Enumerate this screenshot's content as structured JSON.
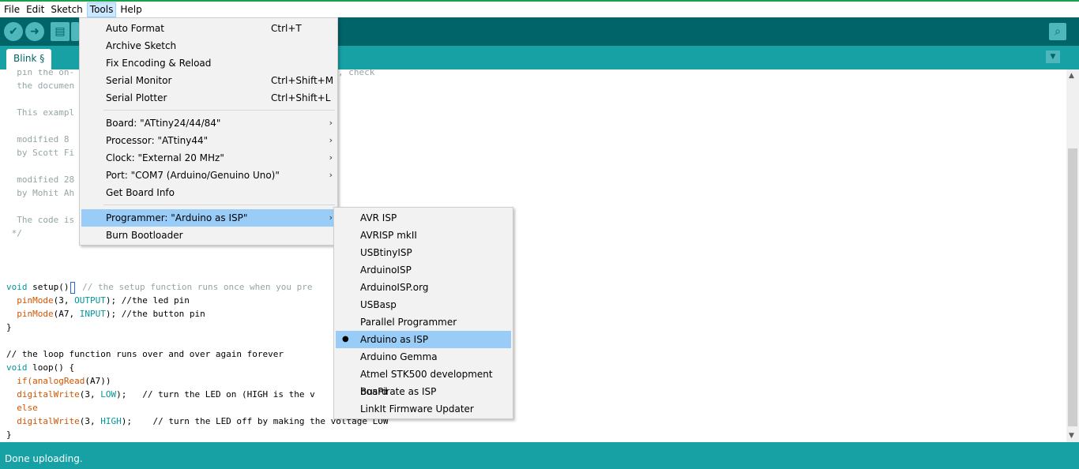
{
  "menubar": [
    "File",
    "Edit",
    "Sketch",
    "Tools",
    "Help"
  ],
  "tab": {
    "label": "Blink §"
  },
  "status": {
    "text": "Done uploading."
  },
  "code": [
    {
      "line": "  pin the on-"
    },
    {
      "line": "  the documen"
    },
    {
      "line": "  This exampl"
    },
    {
      "line": "  modified 8 "
    },
    {
      "line": "  by Scott Fi"
    },
    {
      "line": "  modified 28"
    },
    {
      "line": "  by Mohit Ah"
    },
    {
      "line": "  The code is"
    },
    {
      "line": " */"
    }
  ],
  "code_tail": {
    "check": ", check",
    "setup_kw": "void",
    "setup_rest": " setup()",
    "setup_cmt": " // the setup function runs once when you pre",
    "pm1_fn": "pinMode",
    "pm1_a": "(3, ",
    "pm1_const": "OUTPUT",
    "pm1_b": "); //the led pin",
    "pm2_fn": "pinMode",
    "pm2_a": "(A7, ",
    "pm2_const": "INPUT",
    "pm2_b": "); //the button pin",
    "close1": "}",
    "loop_cmt": "// the loop function runs over and over again forever",
    "loop_kw": "void",
    "loop_rest": " loop() {",
    "if_a": "  if(",
    "if_fn": "analogRead",
    "if_b": "(A7))",
    "dw1_fn": "digitalWrite",
    "dw1_a": "(3, ",
    "dw1_const": "LOW",
    "dw1_b": ");   // turn the LED on (HIGH is the v",
    "else": "  else",
    "dw2_fn": "digitalWrite",
    "dw2_a": "(3, ",
    "dw2_const": "HIGH",
    "dw2_b": ");    // turn the LED off by making the voltage LOW",
    "close2": "}"
  },
  "tools_menu": {
    "items": [
      {
        "label": "Auto Format",
        "shortcut": "Ctrl+T"
      },
      {
        "label": "Archive Sketch",
        "shortcut": ""
      },
      {
        "label": "Fix Encoding & Reload",
        "shortcut": ""
      },
      {
        "label": "Serial Monitor",
        "shortcut": "Ctrl+Shift+M"
      },
      {
        "label": "Serial Plotter",
        "shortcut": "Ctrl+Shift+L"
      },
      {
        "label": "Board: \"ATtiny24/44/84\"",
        "shortcut": ""
      },
      {
        "label": "Processor: \"ATtiny44\"",
        "shortcut": ""
      },
      {
        "label": "Clock: \"External 20 MHz\"",
        "shortcut": ""
      },
      {
        "label": "Port: \"COM7 (Arduino/Genuino Uno)\"",
        "shortcut": ""
      },
      {
        "label": "Get Board Info",
        "shortcut": ""
      },
      {
        "label": "Programmer: \"Arduino as ISP\"",
        "shortcut": ""
      },
      {
        "label": "Burn Bootloader",
        "shortcut": ""
      }
    ]
  },
  "programmer_menu": {
    "items": [
      {
        "label": "AVR ISP"
      },
      {
        "label": "AVRISP mkII"
      },
      {
        "label": "USBtinyISP"
      },
      {
        "label": "ArduinoISP"
      },
      {
        "label": "ArduinoISP.org"
      },
      {
        "label": "USBasp"
      },
      {
        "label": "Parallel Programmer"
      },
      {
        "label": "Arduino as ISP"
      },
      {
        "label": "Arduino Gemma"
      },
      {
        "label": "Atmel STK500 development board"
      },
      {
        "label": "BusPirate as ISP"
      },
      {
        "label": "LinkIt Firmware Updater"
      }
    ],
    "selected": "Arduino as ISP"
  },
  "icons": {
    "verify": "check-icon",
    "upload": "arrow-right-icon",
    "new": "new-file-icon",
    "serial_monitor": "magnifier-icon",
    "tab_menu": "chevron-down-icon"
  },
  "colors": {
    "toolbar": "#006468",
    "tabbar": "#17a1a5",
    "highlight": "#99ccf7"
  }
}
